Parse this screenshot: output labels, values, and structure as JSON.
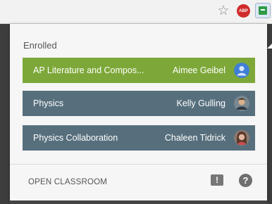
{
  "toolbar": {
    "star_icon": "star-icon",
    "abp_label": "ABP",
    "classroom_icon": "classroom-icon"
  },
  "popup": {
    "heading": "Enrolled",
    "courses": [
      {
        "title": "AP Literature and Compos...",
        "teacher": "Aimee Geibel",
        "color": "#7da839"
      },
      {
        "title": "Physics",
        "teacher": "Kelly Gulling",
        "color": "#576f7d"
      },
      {
        "title": "Physics Collaboration",
        "teacher": "Chaleen Tidrick",
        "color": "#576f7d"
      }
    ],
    "open_label": "OPEN CLASSROOM",
    "feedback_glyph": "!",
    "help_glyph": "?"
  }
}
